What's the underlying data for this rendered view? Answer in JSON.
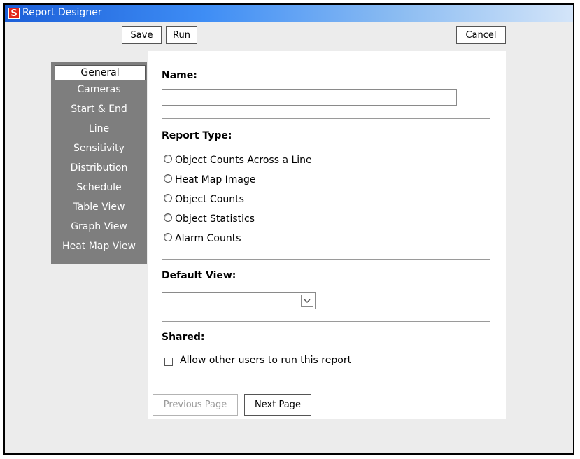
{
  "window": {
    "title": "Report Designer",
    "app_icon_letter": "S"
  },
  "toolbar": {
    "save_label": "Save",
    "run_label": "Run",
    "cancel_label": "Cancel"
  },
  "sidebar": {
    "items": [
      {
        "label": "General",
        "active": true
      },
      {
        "label": "Cameras"
      },
      {
        "label": "Start & End"
      },
      {
        "label": "Line"
      },
      {
        "label": "Sensitivity"
      },
      {
        "label": "Distribution"
      },
      {
        "label": "Schedule"
      },
      {
        "label": "Table View"
      },
      {
        "label": "Graph View"
      },
      {
        "label": "Heat Map View"
      }
    ]
  },
  "form": {
    "name_heading": "Name:",
    "name_value": "",
    "report_type_heading": "Report Type:",
    "report_types": [
      "Object Counts Across a Line",
      "Heat Map Image",
      "Object Counts",
      "Object Statistics",
      "Alarm Counts"
    ],
    "default_view_heading": "Default View:",
    "default_view_value": "",
    "shared_heading": "Shared:",
    "shared_checkbox_label": "Allow other users to run this report",
    "shared_checked": false
  },
  "footer": {
    "previous_label": "Previous Page",
    "next_label": "Next Page"
  }
}
